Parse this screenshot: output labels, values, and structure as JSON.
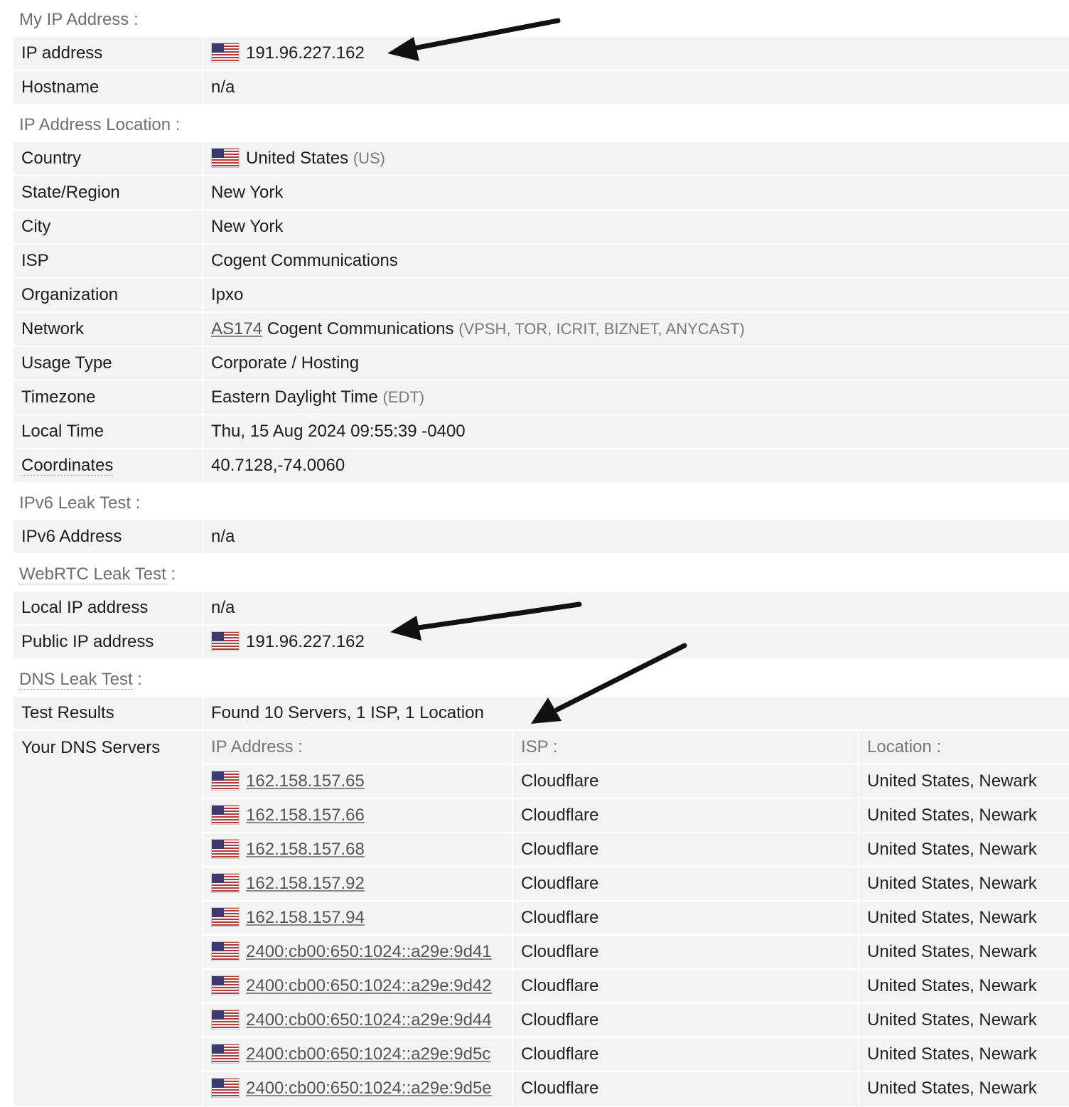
{
  "sections": {
    "my_ip": {
      "title": "My IP Address :",
      "ip_label": "IP address",
      "ip_value": "191.96.227.162",
      "hostname_label": "Hostname",
      "hostname_value": "n/a"
    },
    "location": {
      "title": "IP Address Location :",
      "country_label": "Country",
      "country_value": "United States",
      "country_code": "(US)",
      "region_label": "State/Region",
      "region_value": "New York",
      "city_label": "City",
      "city_value": "New York",
      "isp_label": "ISP",
      "isp_value": "Cogent Communications",
      "org_label": "Organization",
      "org_value": "Ipxo",
      "network_label": "Network",
      "network_as": "AS174",
      "network_name": "Cogent Communications",
      "network_tags": "(VPSH, TOR, ICRIT, BIZNET, ANYCAST)",
      "usage_label": "Usage Type",
      "usage_value": "Corporate / Hosting",
      "tz_label": "Timezone",
      "tz_value": "Eastern Daylight Time",
      "tz_abbr": "(EDT)",
      "localtime_label": "Local Time",
      "localtime_value": "Thu, 15 Aug 2024 09:55:39 -0400",
      "coords_label": "Coordinates",
      "coords_value": "40.7128,-74.0060"
    },
    "ipv6": {
      "title": "IPv6 Leak Test :",
      "addr_label": "IPv6 Address",
      "addr_value": "n/a"
    },
    "webrtc": {
      "title_link": "WebRTC Leak Test",
      "title_suffix": " :",
      "local_label": "Local IP address",
      "local_value": "n/a",
      "public_label": "Public IP address",
      "public_value": "191.96.227.162"
    },
    "dns": {
      "title_link": "DNS Leak Test",
      "title_suffix": " :",
      "results_label": "Test Results",
      "results_value": "Found 10 Servers, 1 ISP, 1 Location",
      "servers_label": "Your DNS Servers",
      "headers": [
        "IP Address :",
        "ISP :",
        "Location :"
      ],
      "servers": [
        {
          "ip": "162.158.157.65",
          "isp": "Cloudflare",
          "location": "United States, Newark"
        },
        {
          "ip": "162.158.157.66",
          "isp": "Cloudflare",
          "location": "United States, Newark"
        },
        {
          "ip": "162.158.157.68",
          "isp": "Cloudflare",
          "location": "United States, Newark"
        },
        {
          "ip": "162.158.157.92",
          "isp": "Cloudflare",
          "location": "United States, Newark"
        },
        {
          "ip": "162.158.157.94",
          "isp": "Cloudflare",
          "location": "United States, Newark"
        },
        {
          "ip": "2400:cb00:650:1024::a29e:9d41",
          "isp": "Cloudflare",
          "location": "United States, Newark"
        },
        {
          "ip": "2400:cb00:650:1024::a29e:9d42",
          "isp": "Cloudflare",
          "location": "United States, Newark"
        },
        {
          "ip": "2400:cb00:650:1024::a29e:9d44",
          "isp": "Cloudflare",
          "location": "United States, Newark"
        },
        {
          "ip": "2400:cb00:650:1024::a29e:9d5c",
          "isp": "Cloudflare",
          "location": "United States, Newark"
        },
        {
          "ip": "2400:cb00:650:1024::a29e:9d5e",
          "isp": "Cloudflare",
          "location": "United States, Newark"
        }
      ]
    }
  },
  "icons": {
    "flag": "us-flag-icon",
    "arrow": "arrow-icon"
  },
  "colors": {
    "row_bg": "#f3f3f3",
    "section_title": "#6e6e6e",
    "muted": "#7a7a7a",
    "arrow": "#111111"
  }
}
